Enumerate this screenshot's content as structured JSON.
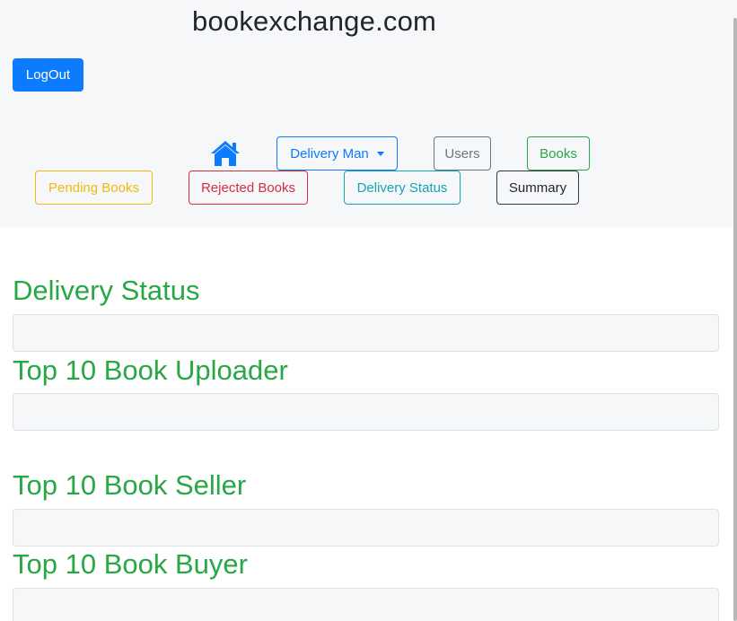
{
  "header": {
    "site_title": "bookexchange.com",
    "logout_label": "LogOut"
  },
  "nav": {
    "home_icon": "home-icon",
    "delivery_man_label": "Delivery Man",
    "users_label": "Users",
    "books_label": "Books",
    "pending_books_label": "Pending Books",
    "rejected_books_label": "Rejected Books",
    "delivery_status_label": "Delivery Status",
    "summary_label": "Summary"
  },
  "sections": [
    {
      "title": "Delivery Status"
    },
    {
      "title": "Top 10 Book Uploader"
    },
    {
      "title": "Top 10 Book Seller"
    },
    {
      "title": "Top 10 Book Buyer"
    }
  ],
  "colors": {
    "primary": "#0d7bfd",
    "secondary": "#6c757d",
    "success": "#28a745",
    "warning": "#f2b90f",
    "danger": "#d42f43",
    "info": "#17a2b8",
    "dark": "#343a40",
    "header_bg": "#f6f7f9"
  }
}
